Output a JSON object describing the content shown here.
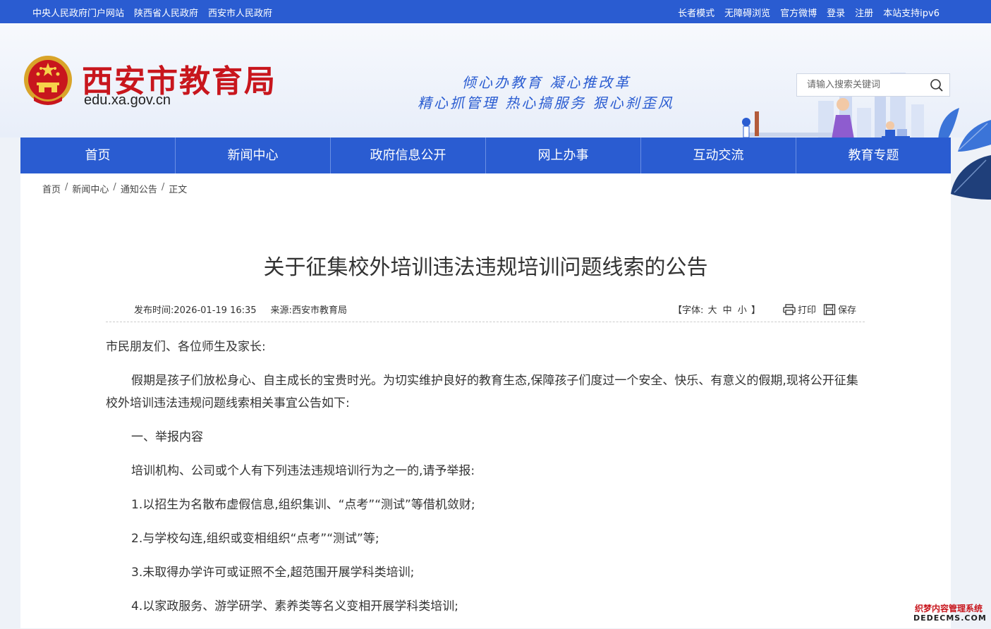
{
  "topbar": {
    "left_links": [
      "中央人民政府门户网站",
      "陕西省人民政府",
      "西安市人民政府"
    ],
    "right_links": [
      "长者模式",
      "无障碍浏览",
      "官方微博",
      "登录",
      "注册",
      "本站支持ipv6"
    ]
  },
  "header": {
    "site_name": "西安市教育局",
    "domain": "edu.xa.gov.cn",
    "slogan_line1": "倾心办教育 凝心推改革",
    "slogan_line2": "精心抓管理 热心搞服务 狠心刹歪风",
    "search_placeholder": "请输入搜索关键词",
    "emblem_icon": "national-emblem-icon",
    "search_icon": "search-icon"
  },
  "nav": {
    "items": [
      "首页",
      "新闻中心",
      "政府信息公开",
      "网上办事",
      "互动交流",
      "教育专题"
    ]
  },
  "breadcrumb": {
    "items": [
      "首页",
      "新闻中心",
      "通知公告",
      "正文"
    ],
    "separator": "/"
  },
  "article": {
    "title": "关于征集校外培训违法违规培训问题线索的公告",
    "publish_label": "发布时间:",
    "publish_time": "2026-01-19 16:35",
    "source_label": "来源:",
    "source": "西安市教育局",
    "font_label_open": "【字体:",
    "font_sizes": [
      "大",
      "中",
      "小"
    ],
    "font_label_close": "】",
    "print_label": "打印",
    "save_label": "保存",
    "print_icon": "printer-icon",
    "save_icon": "floppy-disk-icon",
    "paragraphs": [
      {
        "text": "市民朋友们、各位师生及家长:",
        "indent": false
      },
      {
        "text": "假期是孩子们放松身心、自主成长的宝贵时光。为切实维护良好的教育生态,保障孩子们度过一个安全、快乐、有意义的假期,现将公开征集校外培训违法违规问题线索相关事宜公告如下:",
        "indent": true
      },
      {
        "text": "一、举报内容",
        "indent": true
      },
      {
        "text": "培训机构、公司或个人有下列违法违规培训行为之一的,请予举报:",
        "indent": true
      },
      {
        "text": "1.以招生为名散布虚假信息,组织集训、“点考”“测试”等借机敛财;",
        "indent": true
      },
      {
        "text": "2.与学校勾连,组织或变相组织“点考”“测试”等;",
        "indent": true
      },
      {
        "text": "3.未取得办学许可或证照不全,超范围开展学科类培训;",
        "indent": true
      },
      {
        "text": "4.以家政服务、游学研学、素养类等名义变相开展学科类培训;",
        "indent": true
      }
    ]
  },
  "watermark": {
    "line1": "织梦内容管理系统",
    "line2": "DEDECMS.COM"
  },
  "colors": {
    "brand_blue": "#2a5cd1",
    "brand_red": "#c8161d"
  }
}
